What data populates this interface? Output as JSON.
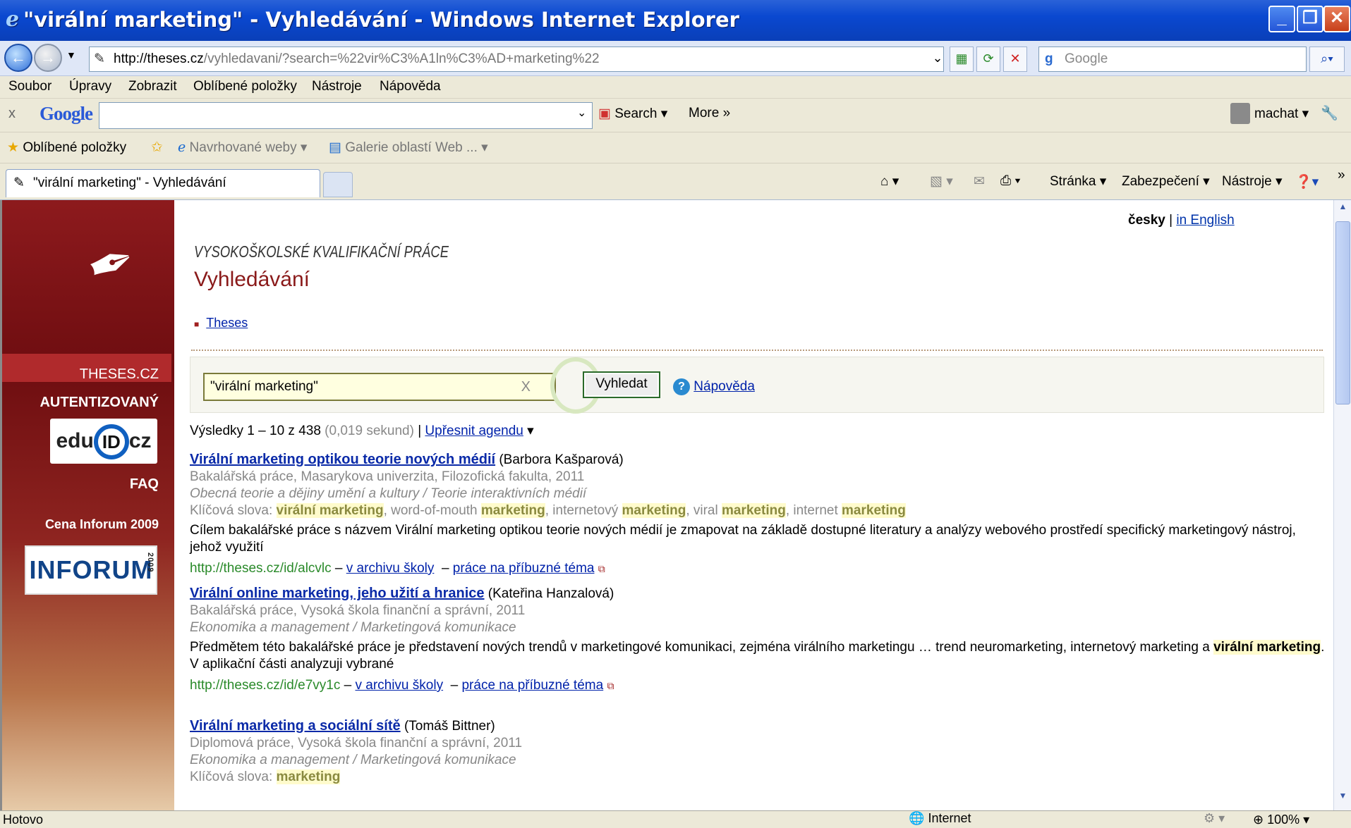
{
  "window": {
    "title": "\"virální marketing\" - Vyhledávání - Windows Internet Explorer"
  },
  "address": {
    "url_host": "http://theses.cz",
    "url_path": "/vyhledavani/?search=%22vir%C3%A1ln%C3%AD+marketing%22",
    "search_placeholder": "Google"
  },
  "menu": [
    "Soubor",
    "Úpravy",
    "Zobrazit",
    "Oblíbené položky",
    "Nástroje",
    "Nápověda"
  ],
  "google_toolbar": {
    "close": "x",
    "logo": "Google",
    "search_label": "Search",
    "more_label": "More »",
    "user": "machat"
  },
  "favorites_bar": {
    "favorites": "Oblíbené položky",
    "suggested": "Navrhované weby",
    "gallery": "Galerie oblastí Web ..."
  },
  "tab": {
    "title": "\"virální marketing\" - Vyhledávání"
  },
  "command_bar": {
    "page": "Stránka",
    "security": "Zabezpečení",
    "tools": "Nástroje"
  },
  "sidebar": {
    "active": "THESES.CZ",
    "auth": "AUTENTIZOVANÝ",
    "faq": "FAQ",
    "award": "Cena Inforum 2009",
    "eduid": "edu",
    "eduid_mid": "ID",
    "eduid_end": "cz",
    "inforum": "INFORUM",
    "inforum_year": "2009"
  },
  "lang": {
    "current": "česky",
    "sep": "|",
    "other": "in English"
  },
  "header": {
    "site": "VYSOKOŠKOLSKÉ KVALIFIKAČNÍ PRÁCE",
    "title": "Vyhledávání"
  },
  "breadcrumb": {
    "item": "Theses"
  },
  "search": {
    "value": "\"virální marketing\"",
    "clear": "X",
    "button": "Vyhledat",
    "help": "Nápověda"
  },
  "summary": {
    "range": "Výsledky 1 – 10 z 438",
    "time": "(0,019 sekund)",
    "sep": "|",
    "refine": "Upřesnit agendu"
  },
  "results": [
    {
      "title": "Virální marketing optikou teorie nových médií",
      "author": "(Barbora Kašparová)",
      "meta": "Bakalářská práce, Masarykova univerzita, Filozofická fakulta, 2011",
      "category": "Obecná teorie a dějiny umění a kultury / Teorie interaktivních médií",
      "keywords_label": "Klíčová slova:",
      "abstract": "Cílem bakalářské práce s názvem Virální marketing optikou teorie nových médií je zmapovat na základě dostupné literatury a analýzy webového prostředí specifický marketingový nástroj, jehož využití",
      "url": "http://theses.cz/id/alcvlc",
      "archive": "v archivu školy",
      "related": "práce na příbuzné téma"
    },
    {
      "title": "Virální online marketing, jeho užití a hranice",
      "author": "(Kateřina Hanzalová)",
      "meta": "Bakalářská práce, Vysoká škola finanční a správní, 2011",
      "category": "Ekonomika a management / Marketingová komunikace",
      "abstract_pre": "Předmětem této bakalářské práce je představení nových trendů v marketingové komunikaci, zejména virálního marketingu … trend neuromarketing, internetový marketing a ",
      "abstract_hl": "virální marketing",
      "abstract_post": ". V aplikační části analyzuji vybrané",
      "url": "http://theses.cz/id/e7vy1c",
      "archive": "v archivu školy",
      "related": "práce na příbuzné téma"
    },
    {
      "title": "Virální marketing a sociální sítě",
      "author": "(Tomáš Bittner)",
      "meta": "Diplomová práce, Vysoká škola finanční a správní, 2011",
      "category": "Ekonomika a management / Marketingová komunikace",
      "keywords_label": "Klíčová slova:",
      "kw": "marketing"
    }
  ],
  "kw1": {
    "a": "virální marketing",
    "b": ", word-of-mouth ",
    "c": "marketing",
    "d": ", internetový ",
    "e": "marketing",
    "f": ", viral ",
    "g": "marketing",
    "h": ", internet ",
    "i": "marketing"
  },
  "status": {
    "text": "Hotovo",
    "zone": "Internet",
    "zoom": "100%"
  }
}
